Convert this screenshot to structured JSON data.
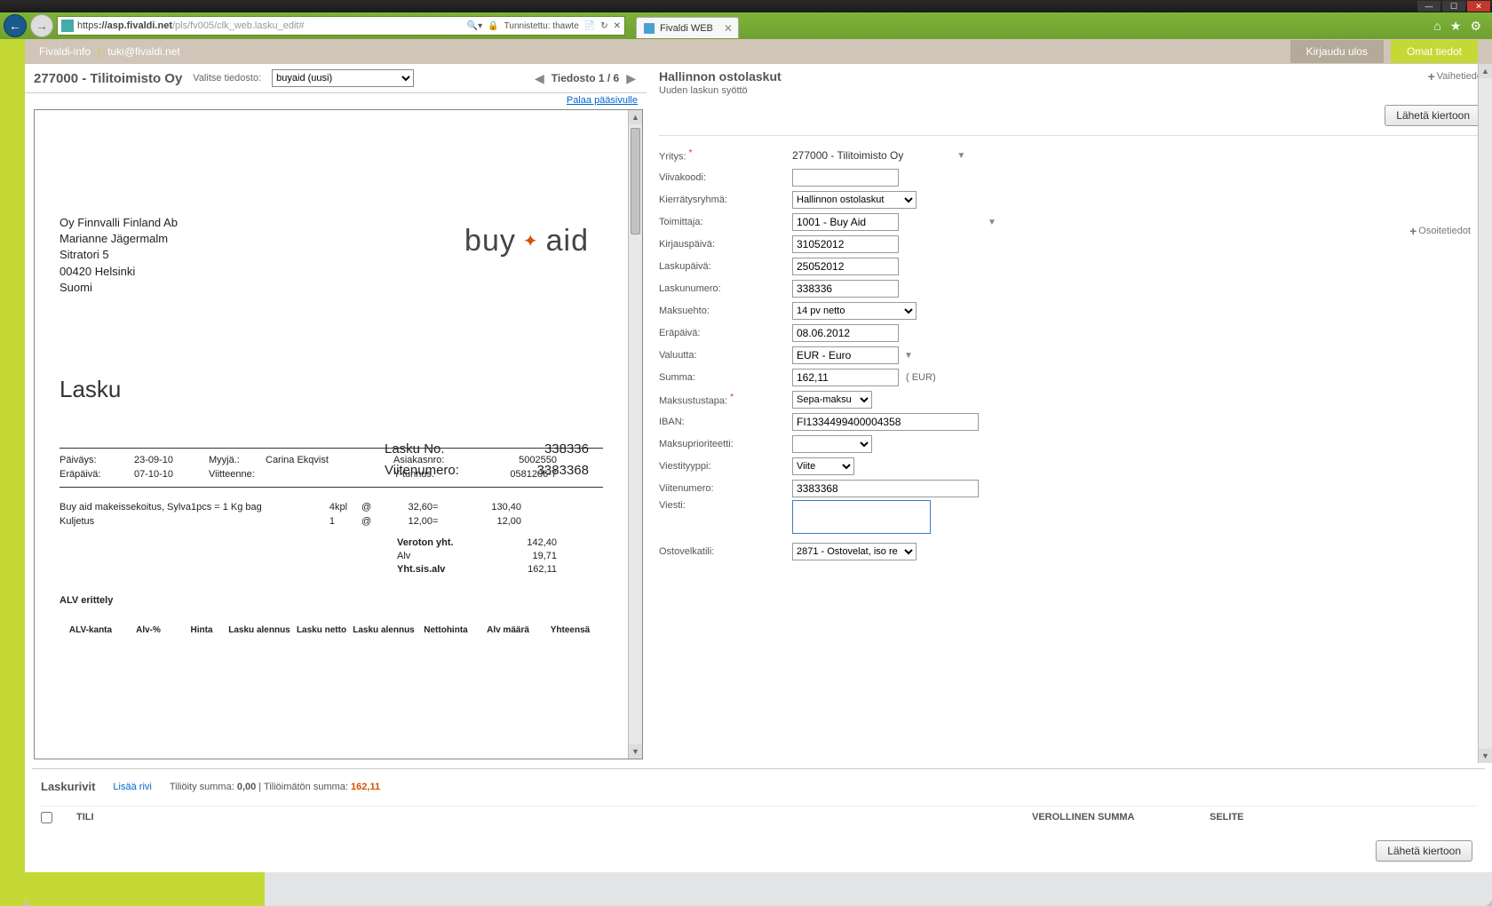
{
  "browser": {
    "url_prefix": "https",
    "url_host": "://asp.fivaldi.net",
    "url_path": "/pls/fv005/clk_web.lasku_edit#",
    "security_text": "Tunnistettu: thawte",
    "tab_title": "Fivaldi WEB"
  },
  "topmenu": {
    "link1": "Fivaldi-info",
    "link2": "tuki@fivaldi.net",
    "logout": "Kirjaudu ulos",
    "own": "Omat tiedot"
  },
  "left": {
    "company": "277000 - Tilitoimisto Oy",
    "file_label": "Valitse tiedosto:",
    "file_select": "buyaid (uusi)",
    "file_counter": "Tiedosto 1 / 6",
    "back_link": "Palaa pääsivulle"
  },
  "invoice": {
    "addr1": "Oy Finnvalli Finland Ab",
    "addr2": "Marianne Jägermalm",
    "addr3": "Sitratori 5",
    "addr4": "00420 Helsinki",
    "addr5": "Suomi",
    "logo_text": "buy   aid",
    "title": "Lasku",
    "num_lbl1": "Lasku No.",
    "num_val1": "338336",
    "num_lbl2": "Viitenumero:",
    "num_val2": "3383368",
    "meta": {
      "paivays_l": "Päiväys:",
      "paivays_v": "23-09-10",
      "erapaiva_l": "Eräpäivä:",
      "erapaiva_v": "07-10-10",
      "myyja_l": "Myyjä.:",
      "myyja_v": "Carina Ekqvist",
      "viite_l": "Viitteenne:",
      "asiakas_l": "Asiakasnro:",
      "asiakas_v": "5002550",
      "ytunnus_l": "Y-tunnus.",
      "ytunnus_v": "0581206-7"
    },
    "line1_desc": "Buy aid makeissekoitus, Sylva1pcs = 1 Kg bag",
    "line2_desc": "Kuljetus",
    "line1_qty": "4",
    "line1_unit": "kpl",
    "line1_at": "@",
    "line1_price": "32,60",
    "line1_eq": "=",
    "line1_total": "130,40",
    "line2_qty": "1",
    "line2_at": "@",
    "line2_price": "12,00",
    "line2_eq": "=",
    "line2_total": "12,00",
    "tot1_l": "Veroton yht.",
    "tot1_v": "142,40",
    "tot2_l": "Alv",
    "tot2_v": "19,71",
    "tot3_l": "Yht.sis.alv",
    "tot3_v": "162,11",
    "alv_title": "ALV erittely",
    "alvh1": "ALV-kanta",
    "alvh2": "Alv-%",
    "alvh3": "Hinta",
    "alvh4": "Lasku alennus",
    "alvh5": "Lasku netto",
    "alvh6": "Lasku alennus",
    "alvh7": "Nettohinta",
    "alvh8": "Alv määrä",
    "alvh9": "Yhteensä"
  },
  "right": {
    "title": "Hallinnon ostolaskut",
    "subtitle": "Uuden laskun syöttö",
    "vaihetiedot": "Vaihetiedot",
    "osoitetiedot": "Osoitetiedot",
    "send_btn": "Lähetä kiertoon",
    "labels": {
      "yritys": "Yritys:",
      "viivakoodi": "Viivakoodi:",
      "kierratys": "Kierrätysryhmä:",
      "toimittaja": "Toimittaja:",
      "kirjauspaiva": "Kirjauspäivä:",
      "laskupaiva": "Laskupäivä:",
      "laskunumero": "Laskunumero:",
      "maksuehto": "Maksuehto:",
      "erapaiva": "Eräpäivä:",
      "valuutta": "Valuutta:",
      "summa": "Summa:",
      "maksutapa": "Maksustustapa:",
      "iban": "IBAN:",
      "maksuprio": "Maksuprioriteetti:",
      "viestityyppi": "Viestityyppi:",
      "viitenumero": "Viitenumero:",
      "viesti": "Viesti:",
      "ostovelkatili": "Ostovelkatili:"
    },
    "values": {
      "yritys": "277000 - Tilitoimisto Oy",
      "kierratys": "Hallinnon ostolaskut",
      "toimittaja": "1001 - Buy Aid",
      "kirjauspaiva": "31052012",
      "laskupaiva": "25052012",
      "laskunumero": "338336",
      "maksuehto": "14 pv netto",
      "erapaiva": "08.06.2012",
      "valuutta": "EUR - Euro",
      "summa": "162,11",
      "summa_cur": "( EUR)",
      "maksutapa": "Sepa-maksu",
      "iban": "FI1334499400004358",
      "viestityyppi": "Viite",
      "viitenumero": "3383368",
      "ostovelkatili": "2871 - Ostovelat, iso re"
    }
  },
  "bottom": {
    "title": "Laskurivit",
    "add_link": "Lisää rivi",
    "sum_label1": "Tiliöity summa: ",
    "sum_val1": "0,00",
    "sum_sep": " | Tiliöimätön summa: ",
    "sum_val2": "162,11",
    "col_tili": "TILI",
    "col_verollinen": "VEROLLINEN SUMMA",
    "col_selite": "SELITE",
    "send_btn": "Lähetä kiertoon"
  }
}
